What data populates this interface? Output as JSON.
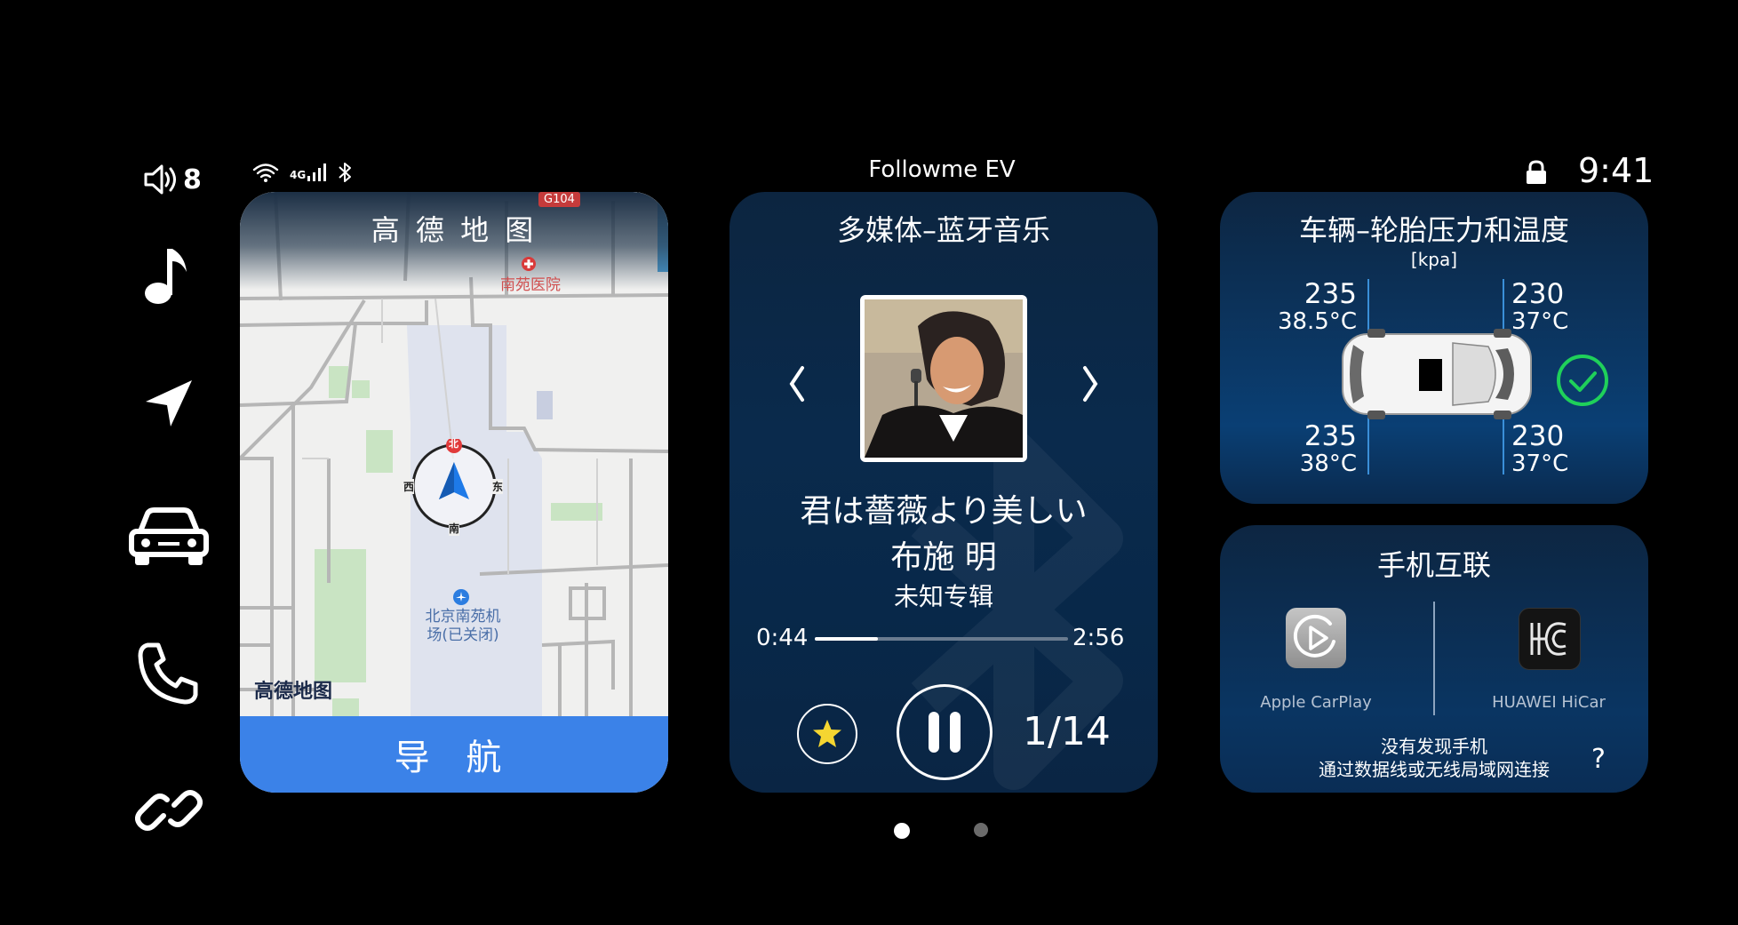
{
  "status_bar": {
    "volume_level": "8",
    "network": "4G",
    "app_title": "Followme EV",
    "time": "9:41"
  },
  "map_card": {
    "title": "高 德 地 图",
    "poi_hospital": "南苑医院",
    "road_badge": "G104",
    "poi_airport_line1": "北京南苑机",
    "poi_airport_line2": "场(已关闭)",
    "logo": "高德地图",
    "compass": {
      "north": "北",
      "south": "南",
      "east": "东",
      "west": "西"
    },
    "nav_button": "导 航"
  },
  "media_card": {
    "title": "多媒体–蓝牙音乐",
    "song_title": "君は薔薇より美しい",
    "artist": "布施 明",
    "album": "未知专辑",
    "elapsed": "0:44",
    "duration": "2:56",
    "progress": 0.25,
    "track_index": "1/14",
    "is_playing": true
  },
  "vehicle_card": {
    "title": "车辆–轮胎压力和温度",
    "unit": "[kpa]",
    "tires": {
      "front_left": {
        "pressure": "235",
        "temp": "38.5°C"
      },
      "front_right": {
        "pressure": "230",
        "temp": "37°C"
      },
      "rear_left": {
        "pressure": "235",
        "temp": "38°C"
      },
      "rear_right": {
        "pressure": "230",
        "temp": "37°C"
      }
    },
    "status_color": "#1fd05a"
  },
  "phone_card": {
    "title": "手机互联",
    "carplay_label": "Apple CarPlay",
    "hicar_label": "HUAWEI HiCar",
    "message_line1": "没有发现手机",
    "message_line2": "通过数据线或无线局域网连接",
    "help": "?"
  },
  "colors": {
    "accent_blue": "#3b82e8",
    "card_dark": "#0c2540",
    "ok_green": "#1fd05a",
    "star_yellow": "#f5d631"
  },
  "pager": {
    "pages": 2,
    "current": 1
  }
}
